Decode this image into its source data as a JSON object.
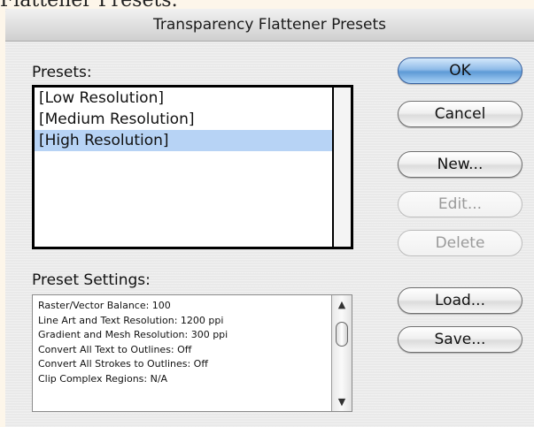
{
  "page_fragment": "Flattener Presets.",
  "window": {
    "title": "Transparency Flattener Presets"
  },
  "presets": {
    "label": "Presets:",
    "items": [
      {
        "label": "[Low Resolution]",
        "selected": false
      },
      {
        "label": "[Medium Resolution]",
        "selected": false
      },
      {
        "label": "[High Resolution]",
        "selected": true
      }
    ]
  },
  "preset_settings": {
    "label": "Preset Settings:",
    "lines": [
      "Raster/Vector Balance: 100",
      "Line Art and Text Resolution: 1200 ppi",
      "Gradient and Mesh Resolution: 300 ppi",
      "Convert All Text to Outlines: Off",
      "Convert All Strokes to Outlines: Off",
      "Clip Complex Regions: N/A"
    ]
  },
  "buttons": {
    "ok": "OK",
    "cancel": "Cancel",
    "new": "New...",
    "edit": "Edit...",
    "delete": "Delete",
    "load": "Load...",
    "save": "Save..."
  },
  "icons": {
    "scroll_up": "▲",
    "scroll_down": "▼"
  },
  "colors": {
    "selection": "#b7d3f5",
    "default_button": "#5d9ad6"
  }
}
